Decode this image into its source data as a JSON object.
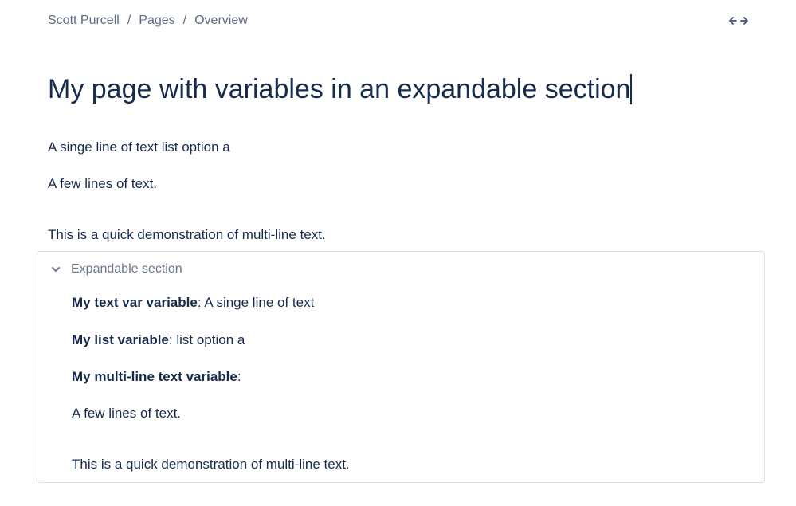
{
  "breadcrumb": {
    "items": [
      "Scott Purcell",
      "Pages",
      "Overview"
    ],
    "separator": "/"
  },
  "header": {
    "width_toggle_icon": "expand-width-arrows-icon"
  },
  "page": {
    "title": "My page with variables in an expandable section",
    "paragraphs": [
      "A singe line of text list option a",
      "A few lines of text.",
      "This is a quick demonstration of multi-line text."
    ]
  },
  "expand": {
    "title": "Expandable section",
    "chevron_icon": "chevron-down-icon",
    "rows": [
      {
        "label": "My text var variable",
        "value": ": A singe line of text"
      },
      {
        "label": "My list variable",
        "value": ":  list option a"
      },
      {
        "label": "My multi-line text variable",
        "value": ":"
      }
    ],
    "paragraphs": [
      "A few lines of text.",
      "This is a quick demonstration of multi-line text."
    ]
  },
  "colors": {
    "text": "#172b4d",
    "muted": "#5e6c84",
    "border": "#dfe1e6"
  }
}
